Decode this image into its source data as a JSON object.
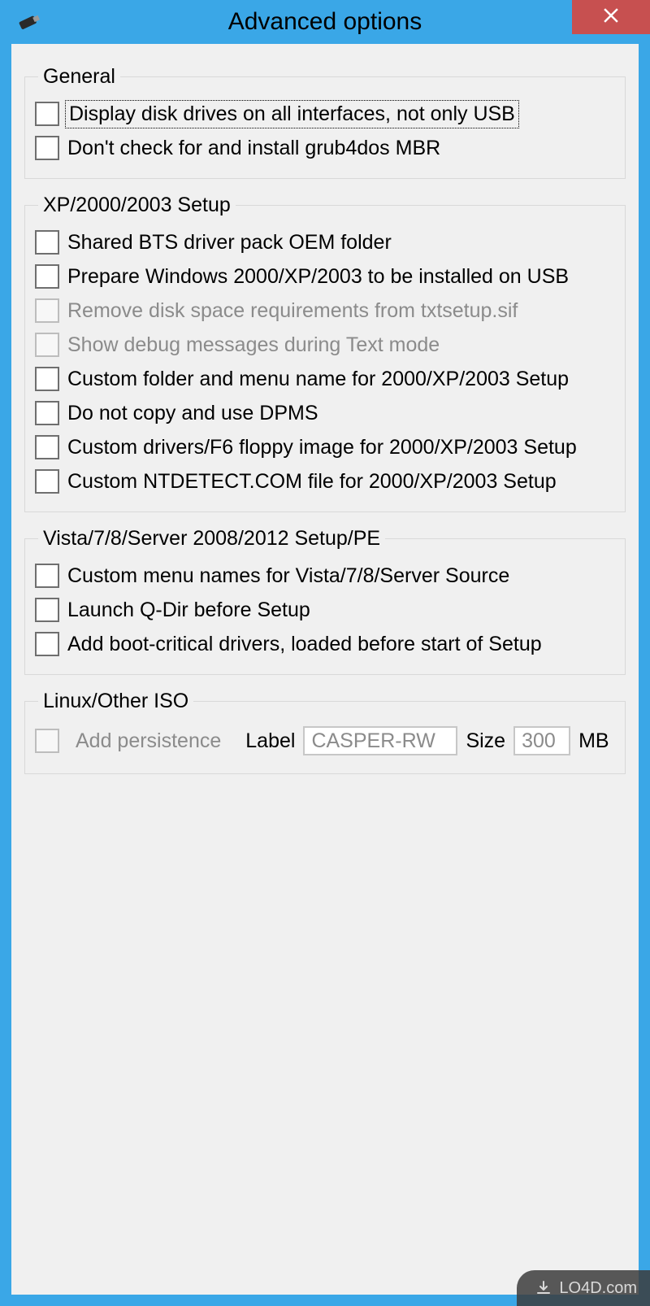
{
  "window": {
    "title": "Advanced options"
  },
  "groups": {
    "general": {
      "legend": "General",
      "items": [
        "Display disk drives on all interfaces, not only USB",
        "Don't check for and install grub4dos MBR"
      ]
    },
    "xp": {
      "legend": "XP/2000/2003 Setup",
      "items": [
        "Shared BTS driver pack OEM folder",
        "Prepare Windows 2000/XP/2003 to be installed on USB",
        "Remove disk space requirements from txtsetup.sif",
        "Show debug messages during Text mode",
        "Custom folder and menu name for 2000/XP/2003 Setup",
        "Do not copy and use DPMS",
        "Custom drivers/F6 floppy image for 2000/XP/2003 Setup",
        "Custom NTDETECT.COM file for 2000/XP/2003 Setup"
      ]
    },
    "vista": {
      "legend": "Vista/7/8/Server 2008/2012 Setup/PE",
      "items": [
        "Custom menu names for Vista/7/8/Server Source",
        "Launch Q-Dir before Setup",
        "Add boot-critical drivers, loaded before start of Setup"
      ]
    },
    "linux": {
      "legend": "Linux/Other ISO",
      "persistence_label": "Add persistence",
      "label_label": "Label",
      "label_value": "CASPER-RW",
      "size_label": "Size",
      "size_value": "300",
      "size_unit": "MB"
    }
  },
  "watermark": "LO4D.com"
}
